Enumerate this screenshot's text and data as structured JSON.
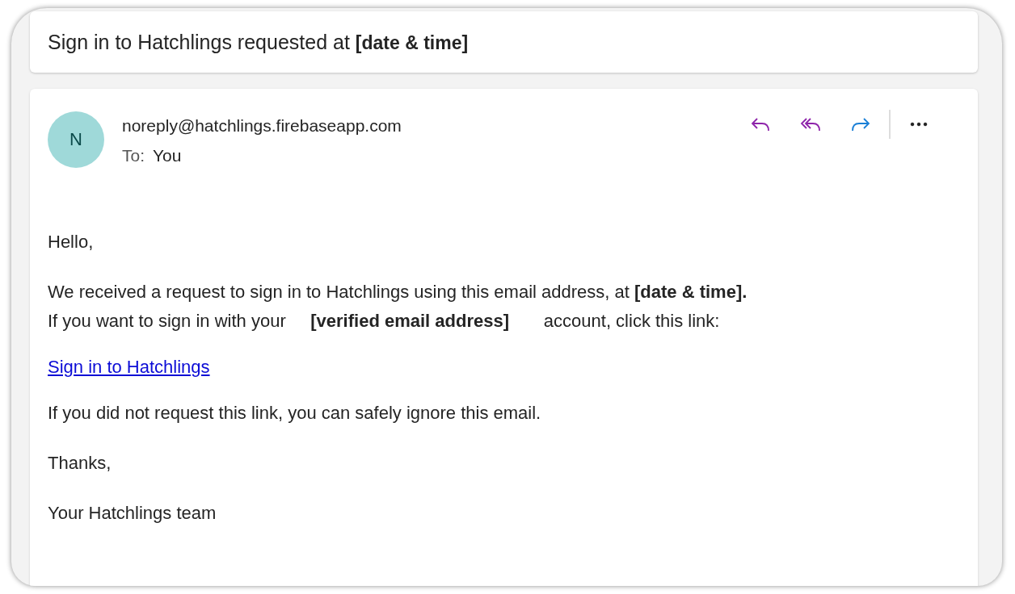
{
  "subject": "Sign in to Hatchlings requested at **[date & time]**",
  "message": {
    "avatar": "N",
    "sender": "noreply@hatchlings.firebaseapp.com",
    "to_label": "To:",
    "to": "You",
    "actions": [
      {
        "kind": "reply"
      },
      {
        "kind": "reply_all"
      },
      {
        "kind": "forward"
      },
      {
        "kind": "more"
      }
    ],
    "body": [
      {
        "kind": "text",
        "lines": [
          "Hello,"
        ]
      },
      {
        "kind": "text",
        "lines": [
          "We received a request to sign in to Hatchlings using this email address, at **[date & time].**",
          "If you want to sign in with your     **[verified email address]**       account, click this link:"
        ]
      },
      {
        "kind": "link",
        "lines": [
          "Sign in to Hatchlings"
        ]
      },
      {
        "kind": "text",
        "lines": [
          "If you did not request this link, you can safely ignore this email."
        ]
      },
      {
        "kind": "text",
        "lines": [
          "Thanks,"
        ]
      },
      {
        "kind": "text",
        "lines": [
          "Your Hatchlings team"
        ]
      }
    ]
  }
}
